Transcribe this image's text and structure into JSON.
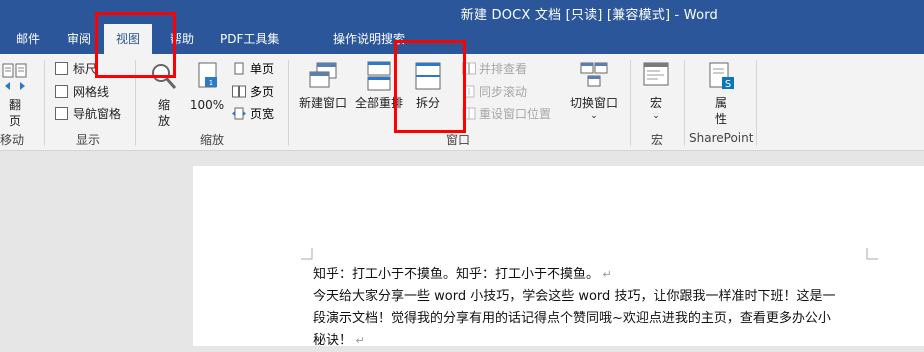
{
  "window": {
    "title": "新建 DOCX 文档 [只读] [兼容模式]  -  Word"
  },
  "tabs": [
    {
      "label": "邮件"
    },
    {
      "label": "审阅"
    },
    {
      "label": "视图"
    },
    {
      "label": "帮助"
    },
    {
      "label": "PDF工具集"
    },
    {
      "label": "操作说明搜索"
    }
  ],
  "ribbon": {
    "page_move": {
      "label_line1": "翻",
      "label_line2": "页",
      "group": "移动"
    },
    "show": {
      "items": [
        {
          "label": "标尺",
          "checked": false
        },
        {
          "label": "网格线",
          "checked": false
        },
        {
          "label": "导航窗格",
          "checked": false
        }
      ],
      "group": "显示"
    },
    "zoom": {
      "zoom_line1": "缩",
      "zoom_line2": "放",
      "percent": "100%",
      "one_page": "单页",
      "multi_page": "多页",
      "page_width": "页宽",
      "group": "缩放"
    },
    "window": {
      "new_window": "新建窗口",
      "arrange_all": "全部重排",
      "split": "拆分",
      "side_by_side": "并排查看",
      "sync_scroll": "同步滚动",
      "reset_position": "重设窗口位置",
      "switch_window": "切换窗口",
      "group": "窗口"
    },
    "macros": {
      "label": "宏",
      "group": "宏"
    },
    "sharepoint": {
      "label_line1": "属",
      "label_line2": "性",
      "group": "SharePoint"
    }
  },
  "document": {
    "lines": [
      "知乎：打工小于不摸鱼。知乎：打工小于不摸鱼。",
      "今天给大家分享一些 word 小技巧，学会这些 word 技巧，让你跟我一样准时下班！这是一",
      "段演示文档！觉得我的分享有用的话记得点个赞同哦~欢迎点进我的主页，查看更多办公小",
      "秘诀！"
    ]
  },
  "colors": {
    "accent": "#2b579a",
    "highlight": "#ff0000"
  }
}
